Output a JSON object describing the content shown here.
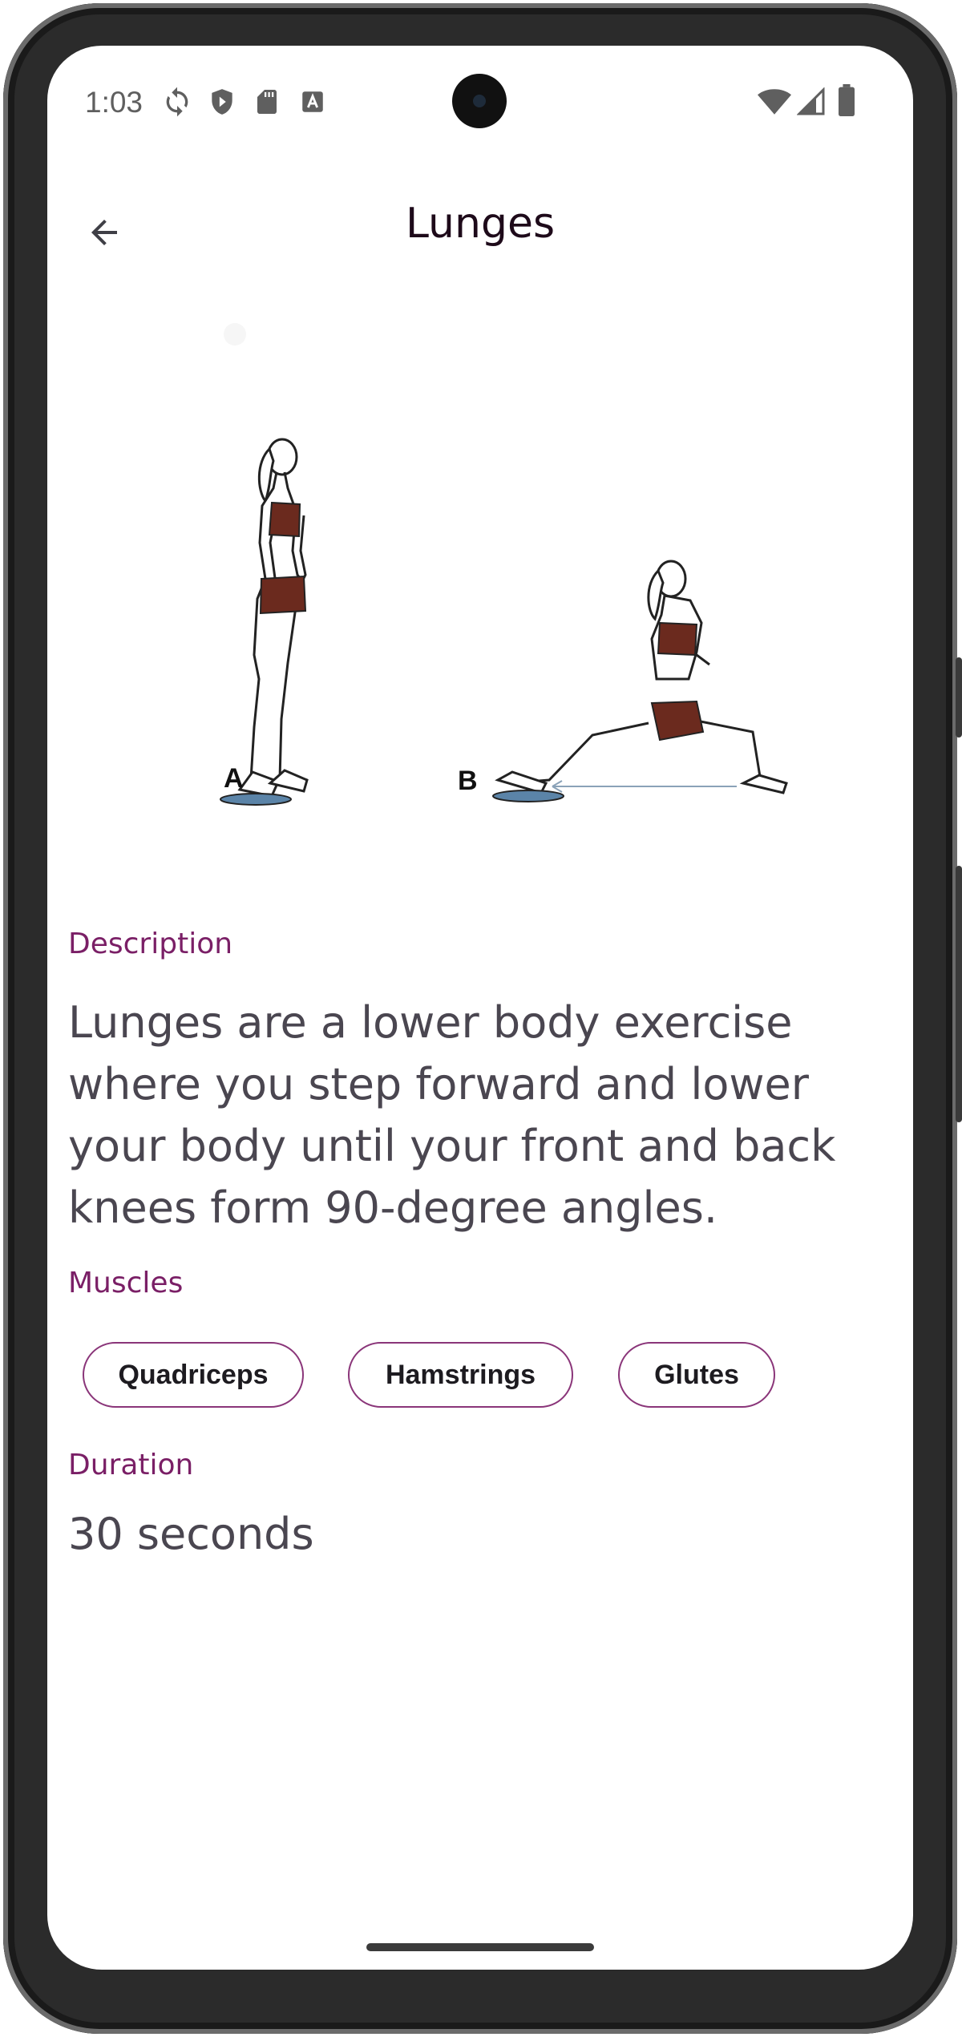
{
  "status_bar": {
    "time": "1:03",
    "icons": [
      "sync-icon",
      "shield-icon",
      "sd-card-icon",
      "font-a-icon"
    ],
    "right_icons": [
      "wifi-icon",
      "signal-icon",
      "battery-icon"
    ]
  },
  "app_bar": {
    "title": "Lunges",
    "back_icon": "arrow-back-icon"
  },
  "illustration": {
    "label_a": "A",
    "label_b": "B"
  },
  "description": {
    "label": "Description",
    "text": "Lunges are a lower body exercise where you step forward and lower your body until your front and back knees form 90-degree angles."
  },
  "muscles": {
    "label": "Muscles",
    "items": [
      "Quadriceps",
      "Hamstrings",
      "Glutes"
    ]
  },
  "duration": {
    "label": "Duration",
    "value": "30 seconds"
  },
  "colors": {
    "accent": "#7a1f66",
    "chip_border": "#8a3579",
    "body_text": "#4a4650",
    "title_text": "#1e0a1a"
  }
}
